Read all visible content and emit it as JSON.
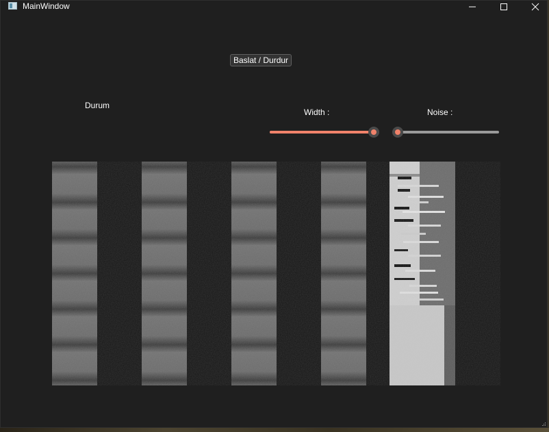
{
  "window": {
    "title": "MainWindow"
  },
  "titlebar_buttons": {
    "minimize_icon": "minimize-icon",
    "maximize_icon": "maximize-icon",
    "close_icon": "close-icon"
  },
  "controls": {
    "start_stop_label": "Baslat / Durdur",
    "status_label": "Durum",
    "width_label": "Width :",
    "noise_label": "Noise :",
    "width_value_fraction": 1.0,
    "noise_value_fraction": 0.0
  },
  "colors": {
    "window_bg": "#1f1f1f",
    "slider_accent": "#f0826a",
    "slider_groove": "#9a9a9a",
    "stripe_light": "#7a7a7a",
    "stripe_dark": "#141414",
    "glitch_white": "#d8d8d8"
  }
}
